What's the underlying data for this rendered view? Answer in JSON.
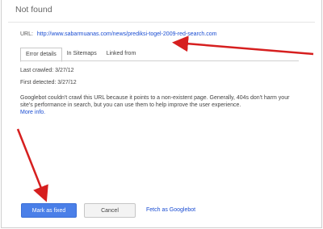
{
  "dialog": {
    "title": "Not found",
    "url_label": "URL:",
    "url": "http://www.sabarmuanas.com/news/prediksi-togel-2009-red-search.com",
    "tabs": [
      {
        "label": "Error details",
        "active": true
      },
      {
        "label": "In Sitemaps",
        "active": false
      },
      {
        "label": "Linked from",
        "active": false
      }
    ],
    "last_crawled": "Last crawled: 3/27/12",
    "first_detected": "First detected: 3/27/12",
    "message": "Googlebot couldn't crawl this URL because it points to a non-existent page. Generally, 404s don't harm your site's performance in search, but you can use them to help improve the user experience.",
    "more_info": "More info.",
    "buttons": {
      "mark_fixed": "Mark as fixed",
      "cancel": "Cancel",
      "fetch": "Fetch as Googlebot"
    }
  },
  "colors": {
    "primary_button": "#4a7fe8",
    "link": "#1a4dd2",
    "annotation_arrow": "#d61f1f"
  }
}
